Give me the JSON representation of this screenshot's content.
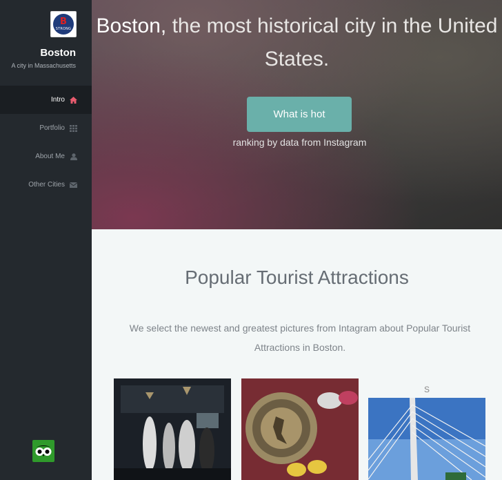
{
  "sidebar": {
    "logo": {
      "letter": "B",
      "word": "STRONG"
    },
    "title": "Boston",
    "subtitle": "A city in Massachusetts",
    "nav": [
      {
        "label": "Intro",
        "icon": "home-icon",
        "active": true
      },
      {
        "label": "Portfolio",
        "icon": "grid-icon",
        "active": false
      },
      {
        "label": "About Me",
        "icon": "user-icon",
        "active": false
      },
      {
        "label": "Other Cities",
        "icon": "envelope-icon",
        "active": false
      }
    ],
    "footer_icon": "tripadvisor-owl-icon"
  },
  "hero": {
    "title_strong": "Boston,",
    "title_rest": " the most historical city in the United States.",
    "button_label": "What is hot",
    "subtitle": "ranking by data from Instagram"
  },
  "attractions": {
    "title": "Popular Tourist Attractions",
    "description": "We select the newest and greatest pictures from Intagram about Popular Tourist Attractions in Boston.",
    "photos": [
      {
        "label": ""
      },
      {
        "label": ""
      },
      {
        "label": "S"
      }
    ]
  },
  "colors": {
    "sidebar": "#24292e",
    "accent": "#6ab0aa",
    "active_icon": "#e75b6e"
  }
}
